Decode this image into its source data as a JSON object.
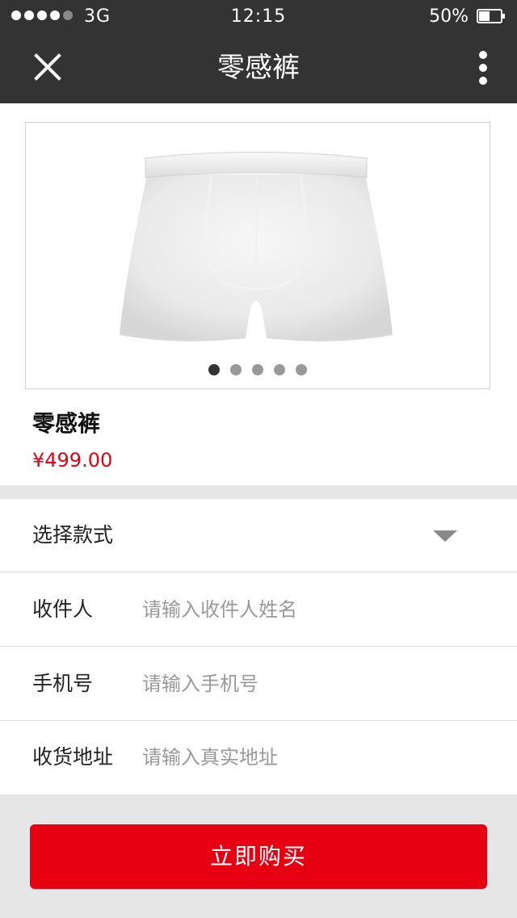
{
  "status_bar": {
    "carrier": "3G",
    "time": "12:15",
    "battery_percent": "50%",
    "battery_level": 0.5,
    "signal_strength": 4,
    "signal_max": 5
  },
  "nav": {
    "title": "零感裤",
    "close_icon": "close-icon",
    "more_icon": "more-vertical-icon"
  },
  "product": {
    "name": "零感裤",
    "price": "¥499.00",
    "image_slides": 5,
    "active_slide": 1
  },
  "form": {
    "style_label": "选择款式",
    "recipient_label": "收件人",
    "recipient_placeholder": "请输入收件人姓名",
    "phone_label": "手机号",
    "phone_placeholder": "请输入手机号",
    "address_label": "收货地址",
    "address_placeholder": "请输入真实地址"
  },
  "actions": {
    "buy_label": "立即购买"
  },
  "colors": {
    "header_bg": "#333333",
    "accent": "#e60012",
    "page_bg": "#e6e6e6",
    "placeholder": "#999999"
  }
}
